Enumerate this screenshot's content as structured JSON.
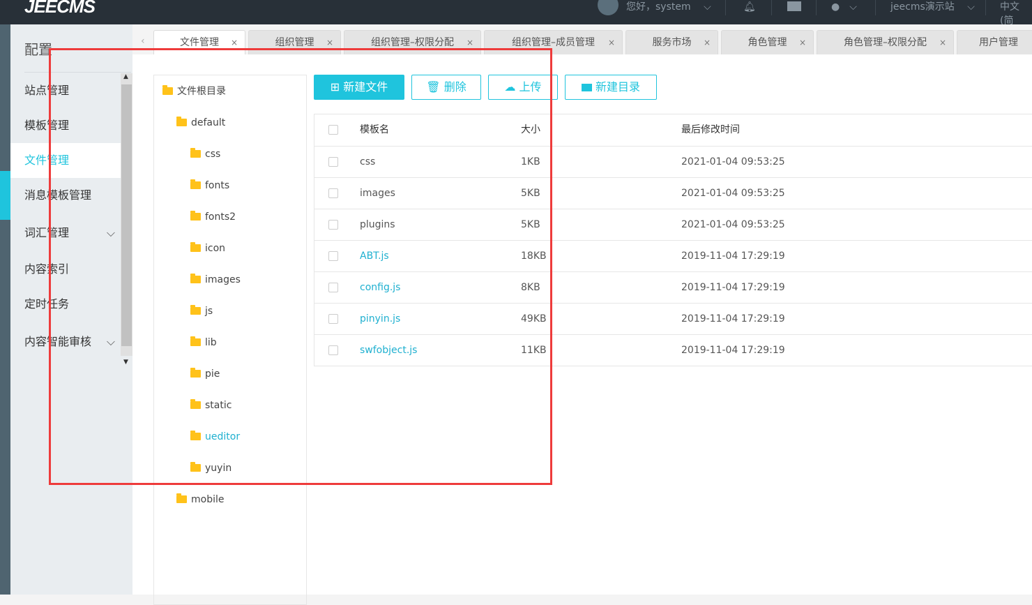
{
  "header": {
    "logo": "JEECMS",
    "greeting": "您好，system",
    "site": "jeecms演示站",
    "lang": "中文(简"
  },
  "sidebar": {
    "title": "配置",
    "items": [
      {
        "label": "站点管理"
      },
      {
        "label": "模板管理"
      },
      {
        "label": "文件管理",
        "active": true
      },
      {
        "label": "消息模板管理"
      },
      {
        "label": "词汇管理",
        "expandable": true
      },
      {
        "label": "内容索引"
      },
      {
        "label": "定时任务"
      },
      {
        "label": "内容智能审核",
        "expandable": true
      }
    ]
  },
  "tabs": [
    {
      "label": "文件管理",
      "active": true
    },
    {
      "label": "组织管理"
    },
    {
      "label": "组织管理–权限分配"
    },
    {
      "label": "组织管理–成员管理"
    },
    {
      "label": "服务市场"
    },
    {
      "label": "角色管理"
    },
    {
      "label": "角色管理–权限分配"
    },
    {
      "label": "用户管理"
    }
  ],
  "tree": {
    "root": "文件根目录",
    "default": "default",
    "children": [
      "css",
      "fonts",
      "fonts2",
      "icon",
      "images",
      "js",
      "lib",
      "pie",
      "static",
      "ueditor",
      "yuyin"
    ],
    "mobile": "mobile"
  },
  "toolbar": {
    "new_file": "新建文件",
    "delete": "删除",
    "upload": "上传",
    "new_dir": "新建目录"
  },
  "table": {
    "headers": [
      "模板名",
      "大小",
      "最后修改时间"
    ],
    "rows": [
      [
        "css",
        "1KB",
        "2021-01-04 09:53:25"
      ],
      [
        "images",
        "5KB",
        "2021-01-04 09:53:25"
      ],
      [
        "plugins",
        "5KB",
        "2021-01-04 09:53:25"
      ],
      [
        "ABT.js",
        "18KB",
        "2019-11-04 17:29:19"
      ],
      [
        "config.js",
        "8KB",
        "2019-11-04 17:29:19"
      ],
      [
        "pinyin.js",
        "49KB",
        "2019-11-04 17:29:19"
      ],
      [
        "swfobject.js",
        "11KB",
        "2019-11-04 17:29:19"
      ]
    ]
  },
  "colors": {
    "accent": "#1fc4dd",
    "highlight": "#ee3b3b"
  }
}
